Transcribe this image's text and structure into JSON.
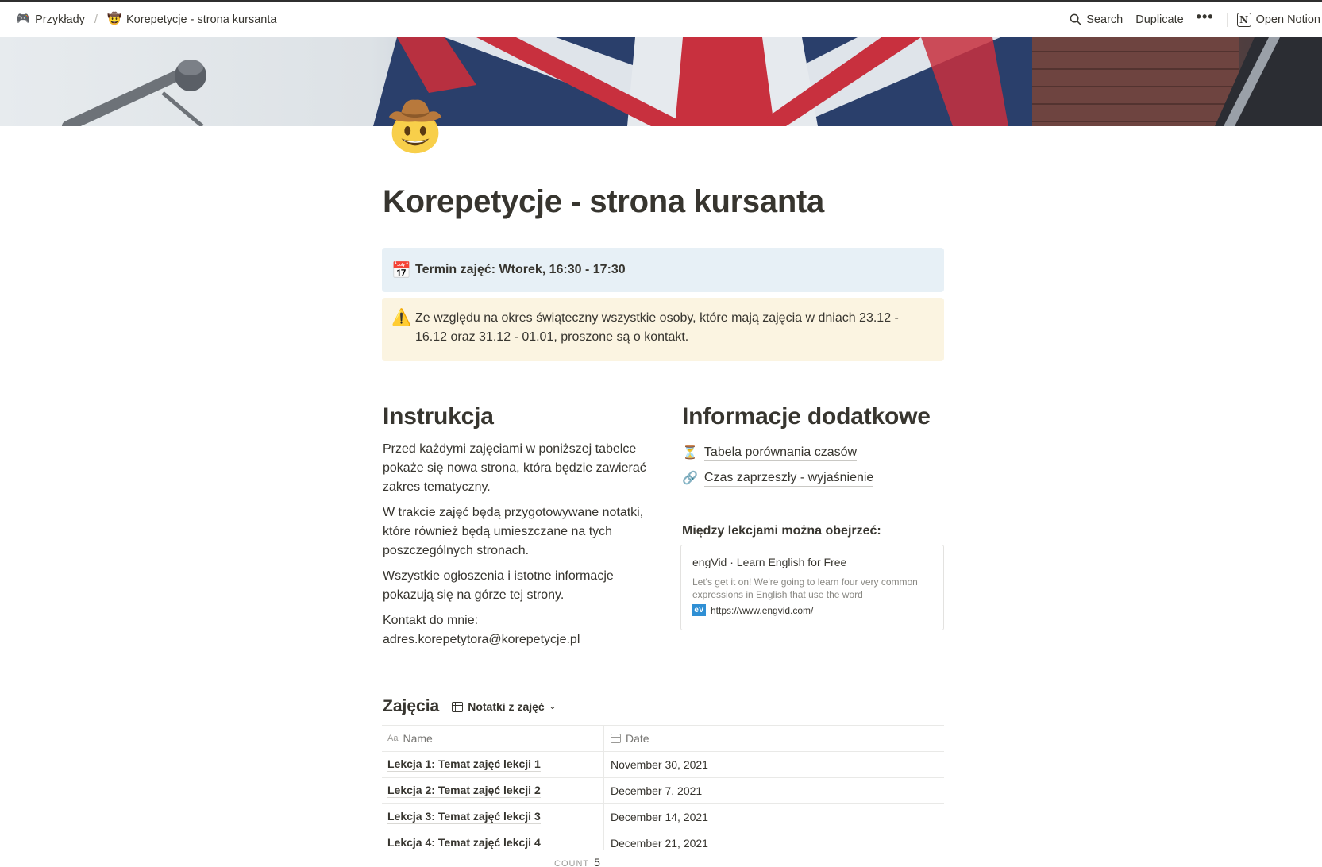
{
  "breadcrumb": {
    "workspace": {
      "icon": "game-controller-icon",
      "glyph": "🎮",
      "label": "Przykłady"
    },
    "separator": "/",
    "page": {
      "icon": "cowboy-face-icon",
      "glyph": "🤠",
      "label": "Korepetycje - strona kursanta"
    }
  },
  "topbar": {
    "search_label": "Search",
    "duplicate_label": "Duplicate",
    "more_label": "•••",
    "open_notion_label": "Open Notion",
    "notion_logo_letter": "N"
  },
  "page": {
    "icon": "cowboy-face-icon",
    "title": "Korepetycje - strona kursanta"
  },
  "callouts": [
    {
      "icon": "calendar-icon",
      "glyph": "📅",
      "text": "Termin zajęć: Wtorek, 16:30 - 17:30",
      "color": "#e7f0f6"
    },
    {
      "icon": "warning-icon",
      "glyph": "⚠️",
      "text": "Ze względu na okres świąteczny wszystkie osoby, które mają zajęcia w dniach 23.12 - 16.12 oraz 31.12 - 01.01, proszone są o kontakt.",
      "color": "#fbf4e1"
    }
  ],
  "instrukcja": {
    "heading": "Instrukcja",
    "paragraphs": [
      "Przed każdymi zajęciami w poniższej tabelce pokaże się nowa strona, która będzie zawierać zakres tematyczny.",
      "W trakcie zajęć będą przygotowywane notatki, które również będą umieszczane na tych poszczególnych stronach.",
      "Wszystkie ogłoszenia i istotne informacje pokazują się na górze tej strony.",
      "Kontakt do mnie: adres.korepetytora@korepetycje.pl"
    ]
  },
  "informacje": {
    "heading": "Informacje dodatkowe",
    "links": [
      {
        "icon": "hourglass-icon",
        "glyph": "⏳",
        "label": "Tabela porównania czasów"
      },
      {
        "icon": "link-icon",
        "glyph": "🔗",
        "label": "Czas zaprzeszły - wyjaśnienie"
      }
    ],
    "subheading": "Między lekcjami można obejrzeć:",
    "bookmark": {
      "title": "engVid · Learn English for Free",
      "description": "Let's get it on! We're going to learn four very common expressions in English that use the word",
      "favicon": "eV",
      "url": "https://www.engvid.com/"
    }
  },
  "database": {
    "title": "Zajęcia",
    "view_label": "Notatki z zajęć",
    "columns": {
      "name": "Name",
      "name_icon": "Aa",
      "date": "Date"
    },
    "rows": [
      {
        "name": "Lekcja 1: Temat zajęć lekcji 1",
        "date": "November 30, 2021"
      },
      {
        "name": "Lekcja 2: Temat zajęć lekcji 2",
        "date": "December 7, 2021"
      },
      {
        "name": "Lekcja 3: Temat zajęć lekcji 3",
        "date": "December 14, 2021"
      },
      {
        "name": "Lekcja 4: Temat zajęć lekcji 4",
        "date": "December 21, 2021"
      }
    ],
    "count_label": "COUNT",
    "count_value": "5"
  }
}
